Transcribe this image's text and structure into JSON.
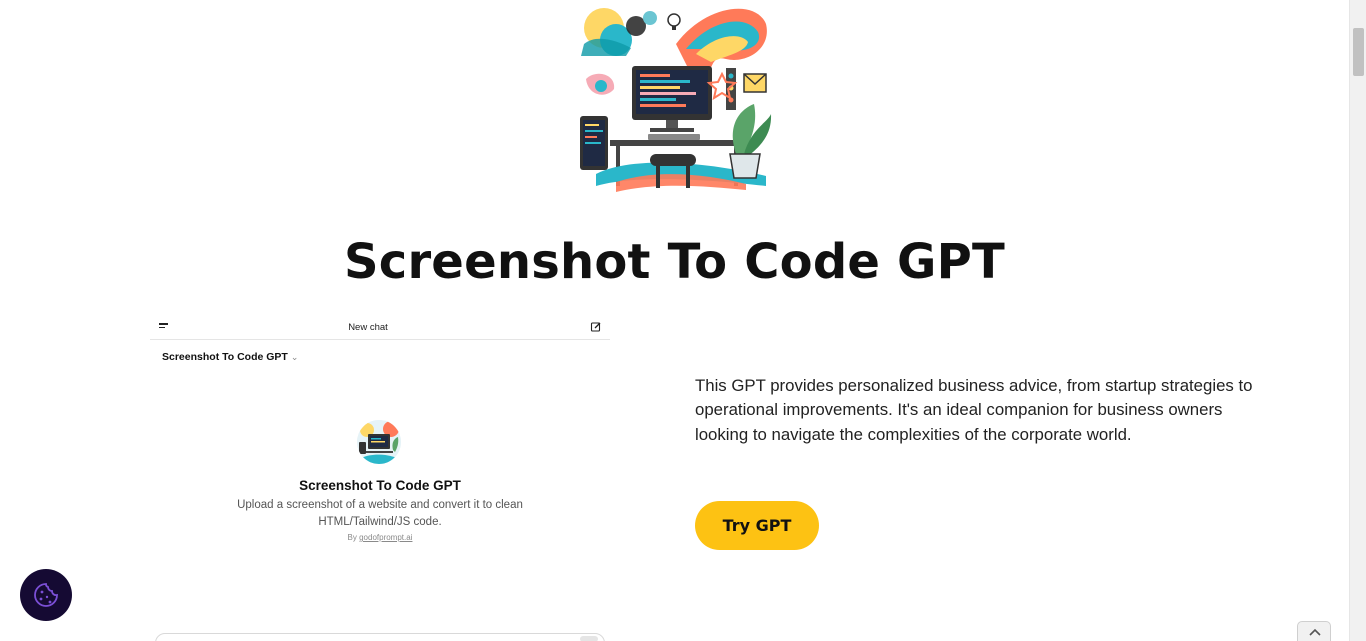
{
  "page": {
    "title": "Screenshot To Code GPT",
    "description": "This GPT provides personalized business advice, from startup strategies to operational improvements. It's an ideal companion for business owners looking to navigate the complexities of the corporate world.",
    "cta_label": "Try GPT",
    "accent_color": "#fdc213"
  },
  "chat_preview": {
    "top_title": "New chat",
    "selector_label": "Screenshot To Code GPT",
    "gpt_name": "Screenshot To Code GPT",
    "gpt_description": "Upload a screenshot of a website and convert it to clean HTML/Tailwind/JS code.",
    "by_prefix": "By ",
    "by_author": "godofprompt.ai"
  },
  "icons": {
    "menu": "menu-icon",
    "edit": "edit-icon",
    "cookie": "cookie-icon",
    "back_to_top": "chevron-up-icon"
  }
}
